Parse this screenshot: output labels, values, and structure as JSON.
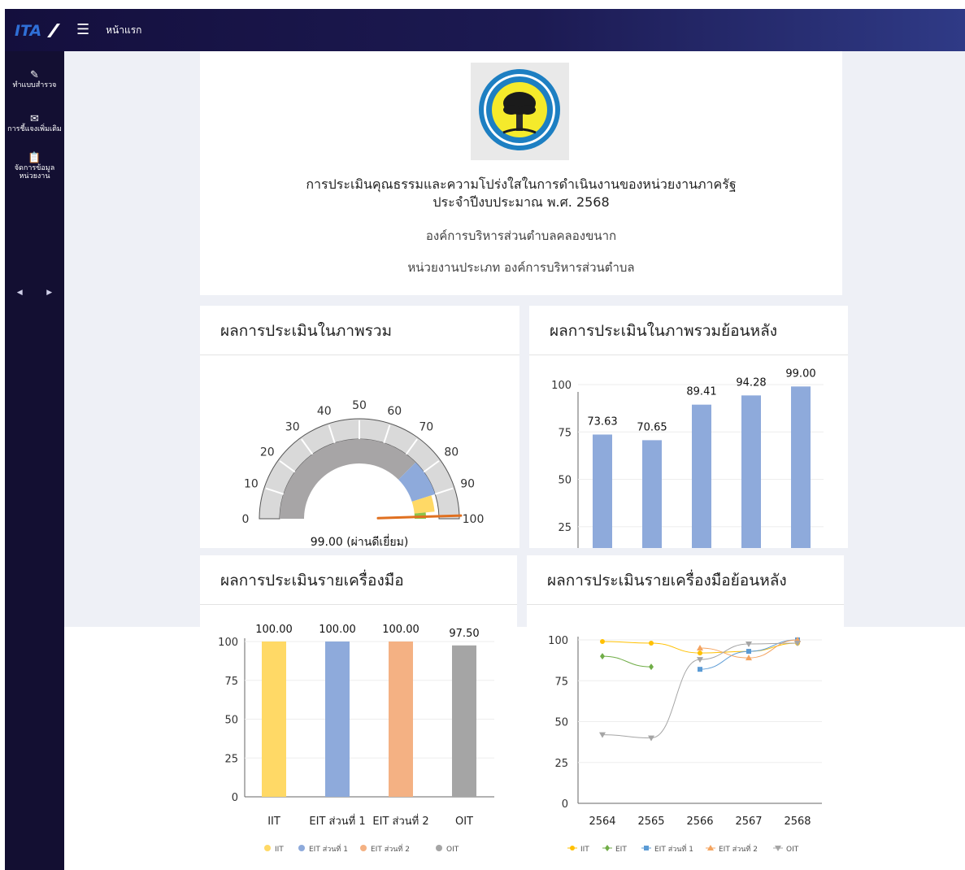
{
  "topbar": {
    "home_label": "หน้าแรก",
    "logo_text": "ITA"
  },
  "sidebar": {
    "items": [
      {
        "label": "ทำแบบสำรวจ",
        "icon": "edit-icon"
      },
      {
        "label": "การชี้แจงเพิ่มเติม",
        "icon": "mail-icon"
      },
      {
        "label_line1": "จัดการข้อมูล",
        "label_line2": "หน่วยงาน",
        "icon": "clipboard-icon"
      }
    ]
  },
  "header": {
    "emblem_text_top": "อบต.คลองขนาก",
    "title_line1": "การประเมินคุณธรรมและความโปร่งใสในการดำเนินงานของหน่วยงานภาครัฐ",
    "title_line2": "ประจำปีงบประมาณ พ.ศ. 2568",
    "org_name": "องค์การบริหารส่วนตำบลคลองขนาก",
    "org_type": "หน่วยงานประเภท องค์การบริหารส่วนตำบล"
  },
  "panels": {
    "overall": "ผลการประเมินในภาพรวม",
    "history": "ผลการประเมินในภาพรวมย้อนหลัง",
    "tools": "ผลการประเมินรายเครื่องมือ",
    "tools_history": "ผลการประเมินรายเครื่องมือย้อนหลัง"
  },
  "chart_data": [
    {
      "type": "gauge",
      "value": 99.0,
      "value_label": "99.00 (ผ่านดีเยี่ยม)",
      "ticks": [
        "0",
        "10",
        "20",
        "30",
        "40",
        "50",
        "60",
        "70",
        "80",
        "90",
        "100"
      ],
      "range": [
        0,
        100
      ],
      "colors": {
        "band": "#a7a5a6",
        "blue": "#8eaadb",
        "yellow": "#ffd966",
        "green": "#8bc34a",
        "needle": "#e07020",
        "outer": "#d9d9d9"
      }
    },
    {
      "type": "bar",
      "values": [
        73.63,
        70.65,
        89.41,
        94.28,
        99.0
      ],
      "value_labels": [
        "73.63",
        "70.65",
        "89.41",
        "94.28",
        "99.00"
      ],
      "y_ticks": [
        "25",
        "50",
        "75",
        "100"
      ],
      "color": "#8eaadb"
    },
    {
      "type": "bar",
      "categories": [
        "IIT",
        "EIT ส่วนที่ 1",
        "EIT ส่วนที่ 2",
        "OIT"
      ],
      "values": [
        100.0,
        100.0,
        100.0,
        97.5
      ],
      "value_labels": [
        "100.00",
        "100.00",
        "100.00",
        "97.50"
      ],
      "colors": [
        "#ffd966",
        "#8eaadb",
        "#f4b183",
        "#a5a5a5"
      ],
      "y_ticks": [
        "0",
        "25",
        "50",
        "75",
        "100"
      ],
      "legend": [
        "IIT",
        "EIT ส่วนที่ 1",
        "EIT ส่วนที่ 2",
        "OIT"
      ]
    },
    {
      "type": "line",
      "x": [
        "2564",
        "2565",
        "2566",
        "2567",
        "2568"
      ],
      "y_ticks": [
        "0",
        "25",
        "50",
        "75",
        "100"
      ],
      "series": [
        {
          "name": "IIT",
          "color": "#ffc000",
          "marker": "circle",
          "values": [
            99,
            98,
            92,
            93,
            98
          ]
        },
        {
          "name": "EIT",
          "color": "#70ad47",
          "marker": "diamond",
          "values": [
            90,
            83.5,
            null,
            null,
            null
          ]
        },
        {
          "name": "EIT ส่วนที่ 1",
          "color": "#5b9bd5",
          "marker": "square",
          "values": [
            null,
            null,
            82,
            93,
            100
          ]
        },
        {
          "name": "EIT ส่วนที่ 2",
          "color": "#f4a460",
          "marker": "triangle",
          "values": [
            null,
            null,
            95,
            89,
            100
          ]
        },
        {
          "name": "OIT",
          "color": "#a5a5a5",
          "marker": "tri-down",
          "values": [
            42,
            40,
            88,
            97.5,
            98
          ]
        }
      ]
    }
  ]
}
